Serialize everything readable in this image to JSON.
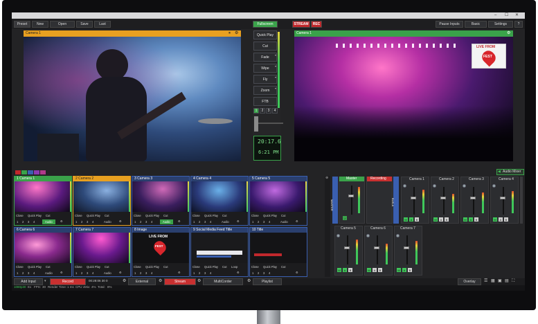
{
  "colors": {
    "accent_orange": "#e8a020",
    "accent_green": "#3aa24a",
    "accent_blue": "#3a5fb0",
    "stream_red": "#c0282c",
    "record_red": "#c83030"
  },
  "window": {
    "min": "–",
    "max": "☐",
    "close": "✕"
  },
  "topbar": {
    "preset": "Preset",
    "new": "New",
    "open": "Open",
    "save": "Save",
    "last": "Last",
    "fullscreen": "Fullscreen",
    "stream": "STREAM",
    "rec": "REC",
    "pause_inputs": "Pause Inputs",
    "basic": "Basic",
    "settings": "Settings",
    "help": "?"
  },
  "preview": {
    "title": "Camera 1"
  },
  "output": {
    "title": "Camera 1",
    "logo_line1": "LIVE FROM",
    "logo_word": "FEST"
  },
  "transitions": {
    "items": [
      "Quick Play",
      "Cut",
      "Fade",
      "Wipe",
      "Fly",
      "Zoom",
      "FTB"
    ],
    "pages": [
      "1",
      "2",
      "3",
      "4"
    ],
    "timecode": "20:17.6",
    "clock": "6:21 PM"
  },
  "audio_mixer_label": "Audio Mixer",
  "inputs": [
    {
      "num": "1",
      "name": "Camera 1",
      "state": "live"
    },
    {
      "num": "2",
      "name": "Camera 2",
      "state": "preview"
    },
    {
      "num": "3",
      "name": "Camera 3",
      "state": "normal"
    },
    {
      "num": "4",
      "name": "Camera 4",
      "state": "normal"
    },
    {
      "num": "5",
      "name": "Camera 5",
      "state": "normal"
    },
    {
      "num": "6",
      "name": "Camera 6",
      "state": "normal"
    },
    {
      "num": "7",
      "name": "Camera 7",
      "state": "normal"
    },
    {
      "num": "8",
      "name": "Image",
      "state": "normal"
    },
    {
      "num": "9",
      "name": "Social Media Feed Title",
      "state": "normal"
    },
    {
      "num": "10",
      "name": "Title",
      "state": "normal"
    }
  ],
  "input_controls": {
    "close": "Close",
    "quick_play": "Quick Play",
    "cut": "Cut",
    "loop": "Loop",
    "audio": "Audio",
    "nums": [
      "1",
      "2",
      "3",
      "4"
    ],
    "time": "00:28:06 30 0"
  },
  "mixer": {
    "master": "Master",
    "recording": "Recording",
    "vertical_master": "MASTER",
    "vertical_bus": "BUS-A",
    "channels_top": [
      "Camera 1",
      "Camera 2",
      "Camera 3",
      "Camera 4"
    ],
    "channels_bottom": [
      "Camera 5",
      "Camera 6",
      "Camera 7"
    ],
    "m": "M",
    "a": "A",
    "b": "B"
  },
  "bottombar": {
    "add_input": "Add Input",
    "record": "Record",
    "rec_time": "00:28:06 30 0",
    "external": "External",
    "stream": "Stream",
    "multicorder": "MultiCorder",
    "playlist": "Playlist",
    "overlay": "Overlay"
  },
  "status": {
    "res": "1080p30",
    "ex_label": "Ex",
    "fps_label": "FPS:",
    "fps": "30",
    "render_label": "Render Time:",
    "render": "1 ms",
    "cpu_label": "CPU vMix:",
    "cpu": "4%",
    "total_label": "Total:",
    "total": "8%"
  }
}
